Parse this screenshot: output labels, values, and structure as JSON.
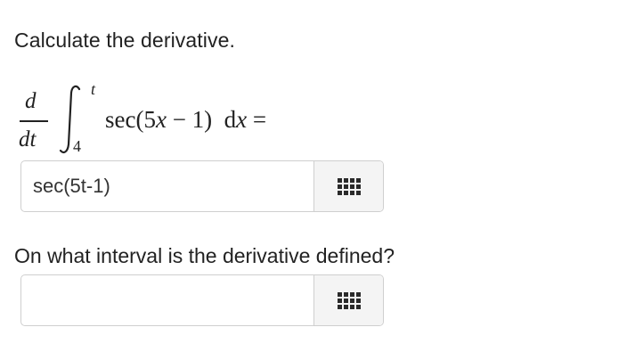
{
  "question": {
    "prompt": "Calculate the derivative."
  },
  "equation": {
    "d_numerator": "d",
    "d_denominator": "dt",
    "integral_upper_limit": "t",
    "integral_lower_limit": "4",
    "integrand_prefix": "sec(5",
    "integrand_var": "x",
    "integrand_suffix": " − 1)  d",
    "differential_var": "x",
    "equals": " ="
  },
  "answer1": {
    "value": "sec(5t-1)",
    "palette_icon": "grid-icon"
  },
  "question2": {
    "prompt": "On what interval is the derivative defined?"
  },
  "answer2": {
    "value": "",
    "palette_icon": "grid-icon"
  }
}
